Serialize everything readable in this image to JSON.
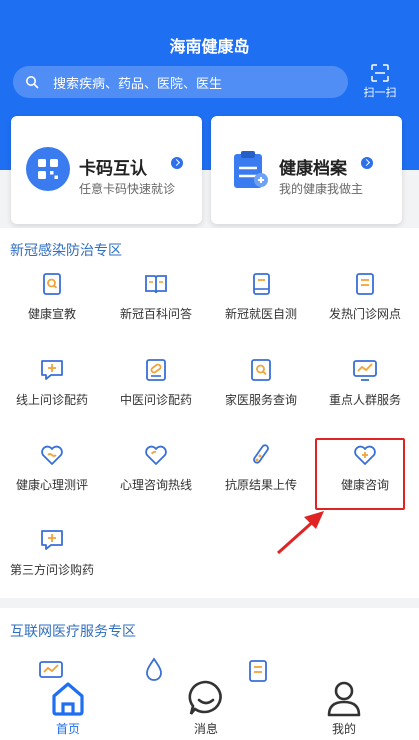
{
  "header": {
    "title": "海南健康岛",
    "search_placeholder": "搜索疾病、药品、医院、医生",
    "scan_label": "扫一扫"
  },
  "cards": [
    {
      "title": "卡码互认",
      "subtitle": "任意卡码快速就诊"
    },
    {
      "title": "健康档案",
      "subtitle": "我的健康我做主"
    }
  ],
  "section1": {
    "title": "新冠感染防治专区",
    "items": [
      {
        "label": "健康宣教",
        "icon": "search-document-icon"
      },
      {
        "label": "新冠百科问答",
        "icon": "book-icon"
      },
      {
        "label": "新冠就医自测",
        "icon": "notebook-icon"
      },
      {
        "label": "发热门诊网点",
        "icon": "receipt-icon"
      },
      {
        "label": "线上问诊配药",
        "icon": "chat-plus-icon"
      },
      {
        "label": "中医问诊配药",
        "icon": "pill-icon"
      },
      {
        "label": "家医服务查询",
        "icon": "doc-search-icon"
      },
      {
        "label": "重点人群服务",
        "icon": "monitor-chart-icon"
      },
      {
        "label": "健康心理测评",
        "icon": "heart-wave-icon"
      },
      {
        "label": "心理咨询热线",
        "icon": "heart-outline-icon"
      },
      {
        "label": "抗原结果上传",
        "icon": "test-tube-icon"
      },
      {
        "label": "健康咨询",
        "icon": "heart-plus-icon"
      },
      {
        "label": "第三方问诊购药",
        "icon": "chat-plus-icon"
      }
    ]
  },
  "section2": {
    "title": "互联网医疗服务专区"
  },
  "tabbar": {
    "items": [
      {
        "label": "首页",
        "icon": "home-icon"
      },
      {
        "label": "消息",
        "icon": "message-icon"
      },
      {
        "label": "我的",
        "icon": "user-icon"
      }
    ]
  },
  "colors": {
    "primary": "#1f6ff2",
    "section_title": "#2f6fc0",
    "highlight": "#e02424"
  }
}
